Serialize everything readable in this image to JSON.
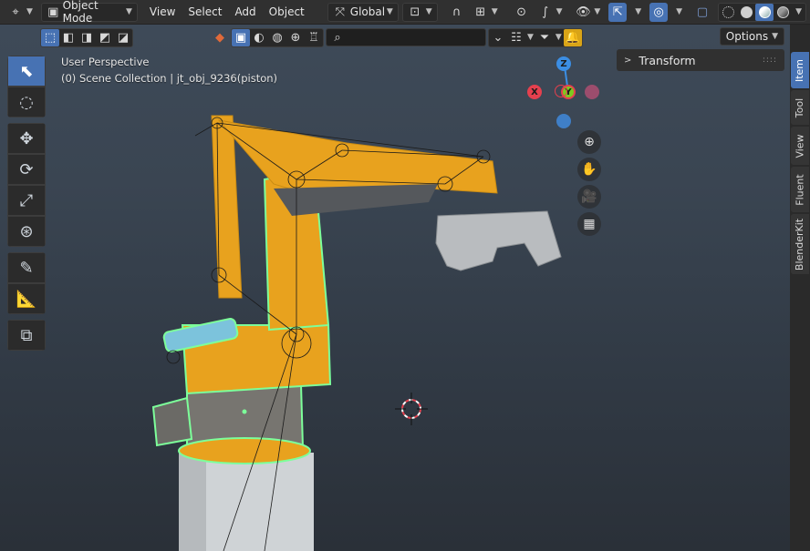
{
  "header": {
    "mode": "Object Mode",
    "menus": [
      "View",
      "Select",
      "Add",
      "Object"
    ],
    "orientation": "Global"
  },
  "viewport": {
    "perspective_label": "User Perspective",
    "collection_label": "(0) Scene Collection | jt_obj_9236(piston)",
    "options_label": "Options",
    "search_placeholder": ""
  },
  "gizmo": {
    "x": "X",
    "y": "Y",
    "z": "Z"
  },
  "sidebar": {
    "panel_title": "Transform",
    "tabs": [
      "Item",
      "Tool",
      "View",
      "Fluent",
      "BlenderKit"
    ],
    "active_tab": "Item"
  },
  "colors": {
    "accent": "#4772b3",
    "axis_x": "#e5404e",
    "axis_y": "#7ccb1f",
    "axis_z": "#3b8ee4",
    "robot": "#e8a21e",
    "selection": "#7dff9a"
  }
}
